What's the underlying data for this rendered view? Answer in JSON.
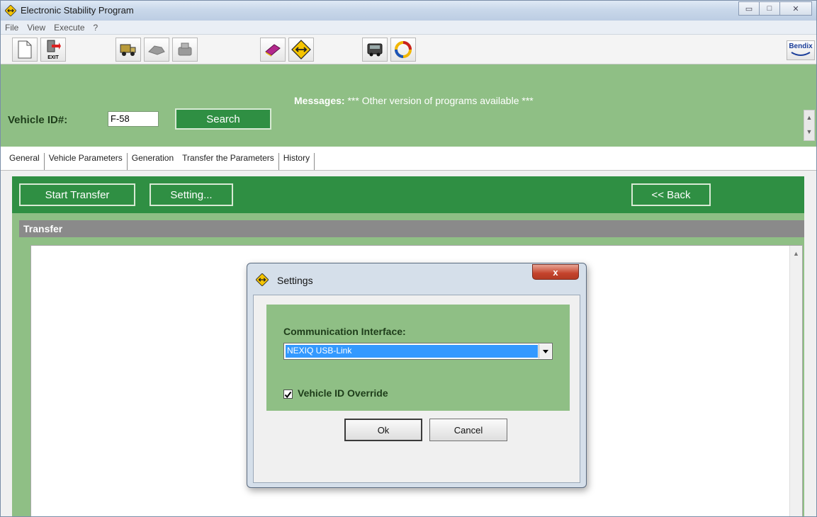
{
  "window": {
    "title": "Electronic Stability Program",
    "controls": {
      "minimize": "▭",
      "maximize": "□",
      "close": "✕"
    }
  },
  "menu": [
    "File",
    "View",
    "Execute",
    "?"
  ],
  "toolbar": {
    "exit_label": "EXIT",
    "brand_label": "Bendix"
  },
  "header": {
    "vehicle_id_label": "Vehicle ID#:",
    "vehicle_id_value": "F-58",
    "search_label": "Search",
    "messages_label": "Messages:",
    "messages_text": "*** Other version of programs available ***"
  },
  "tabs": [
    "General",
    "Vehicle Parameters",
    "Generation",
    "Transfer the Parameters",
    "History"
  ],
  "active_tab": "Transfer the Parameters",
  "actions": {
    "start_transfer_label": "Start Transfer",
    "setting_label": "Setting...",
    "back_label": "<< Back"
  },
  "section": {
    "title": "Transfer"
  },
  "dialog": {
    "title": "Settings",
    "close_label": "x",
    "interface_label": "Communication Interface:",
    "interface_value": "NEXIQ USB-Link",
    "override_label": "Vehicle ID Override",
    "override_checked": true,
    "ok_label": "Ok",
    "cancel_label": "Cancel"
  },
  "colors": {
    "panel_green": "#8fbf85",
    "button_green": "#2f8f43",
    "section_gray": "#8a8a8a",
    "select_highlight": "#3399ff"
  }
}
